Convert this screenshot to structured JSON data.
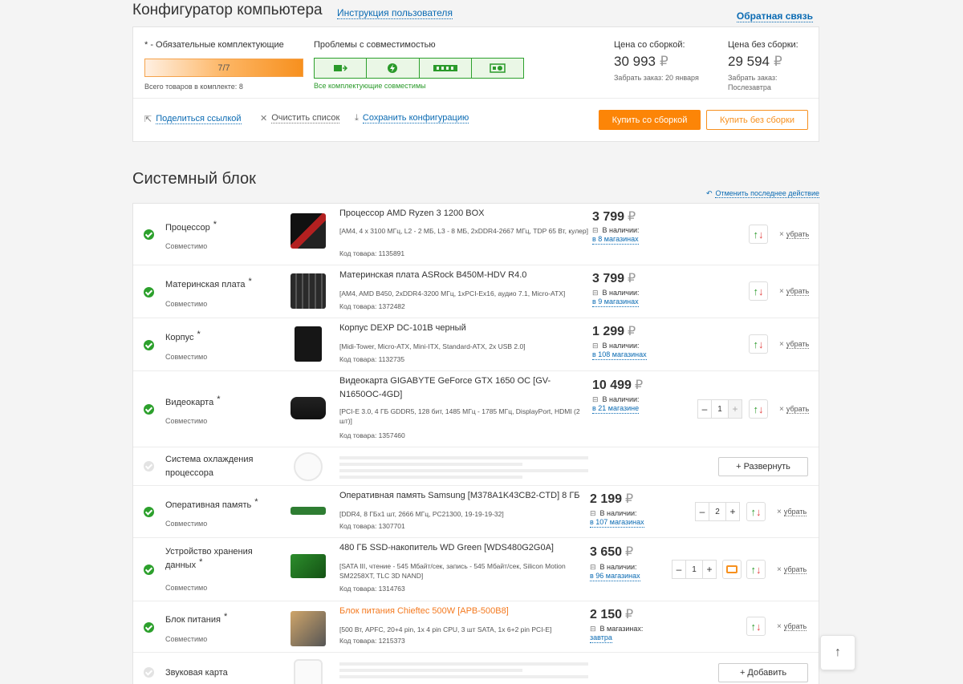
{
  "header": {
    "title": "Конфигуратор компьютера",
    "guide_link": "Инструкция пользователя",
    "feedback_link": "Обратная связь"
  },
  "summary": {
    "required_note": "* - Обязательные комплектующие",
    "progress_text": "7/7",
    "progress_fraction": 1.0,
    "total_items": "Всего товаров в комплекте: 8",
    "compat_title": "Проблемы с совместимостью",
    "compat_status": "Все комплектующие совместимы",
    "compat_icons": [
      "motherboard-icon",
      "power-icon",
      "ram-icon",
      "gpu-icon"
    ],
    "price_with_build_label": "Цена со сборкой:",
    "price_with_build": "30 993",
    "pickup_with_build": "Забрать заказ: 20 января",
    "price_without_build_label": "Цена без сборки:",
    "price_without_build": "29 594",
    "pickup_without_build": "Забрать заказ: Послезавтра",
    "currency": "₽",
    "share_link": "Поделиться ссылкой",
    "clear_list": "Очистить список",
    "save_config": "Сохранить конфигурацию",
    "buy_with_build": "Купить со сборкой",
    "buy_without_build": "Купить без сборки"
  },
  "section": {
    "title": "Системный блок",
    "undo": "Отменить последнее действие"
  },
  "labels": {
    "compatible": "Совместимо",
    "in_stock": "В наличии:",
    "in_stores": "В магазинах:",
    "remove": "убрать",
    "star": "*"
  },
  "rows": [
    {
      "category": "Процессор",
      "name": "Процессор AMD Ryzen 3 1200 BOX",
      "specs": "[AM4, 4 x 3100 МГц, L2 - 2 МБ, L3 - 8 МБ, 2xDDR4-2667 МГц, TDP 65 Вт, кулер]",
      "code": "Код товара: 1135891",
      "price": "3 799",
      "stores": "в 8 магазинах"
    },
    {
      "category": "Материнская плата",
      "name": "Материнская плата ASRock B450M-HDV R4.0",
      "specs": "[AM4, AMD B450, 2xDDR4-3200 МГц, 1xPCI-Ex16, аудио 7.1, Micro-ATX]",
      "code": "Код товара: 1372482",
      "price": "3 799",
      "stores": "в 9 магазинах"
    },
    {
      "category": "Корпус",
      "name": "Корпус DEXP DC-101B черный",
      "specs": "[Midi-Tower, Micro-ATX, Mini-ITX, Standard-ATX, 2x USB 2.0]",
      "code": "Код товара: 1132735",
      "price": "1 299",
      "stores": "в 108 магазинах"
    },
    {
      "category": "Видеокарта",
      "name": "Видеокарта GIGABYTE GeForce GTX 1650 OC [GV-N1650OC-4GD]",
      "specs": "[PCI-E 3.0, 4 ГБ GDDR5, 128 бит, 1485 МГц - 1785 МГц, DisplayPort, HDMI (2 шт)]",
      "code": "Код товара: 1357460",
      "price": "10 499",
      "stores": "в 21 магазине",
      "qty": "1"
    },
    {
      "category": "Система охлаждения процессора",
      "expand": "+ Развернуть"
    },
    {
      "category": "Оперативная память",
      "name": "Оперативная память Samsung [M378A1K43CB2-CTD] 8 ГБ",
      "specs": "[DDR4, 8 ГБx1 шт, 2666 МГц, PC21300, 19-19-19-32]",
      "code": "Код товара: 1307701",
      "price": "2 199",
      "stores": "в 107 магазинах",
      "qty": "2"
    },
    {
      "category": "Устройство хранения данных",
      "name": "480 ГБ SSD-накопитель WD Green [WDS480G2G0A]",
      "specs": "[SATA III, чтение - 545 Мбайт/сек, запись - 545 Мбайт/сек, Silicon Motion SM2258XT, TLC 3D NAND]",
      "code": "Код товара: 1314763",
      "price": "3 650",
      "stores": "в 96 магазинах",
      "qty": "1"
    },
    {
      "category": "Блок питания",
      "name": "Блок питания Chieftec 500W [APB-500B8]",
      "specs": "[500 Вт, APFC, 20+4 pin, 1x 4 pin CPU, 3 шт SATA, 1x 6+2 pin PCI-E]",
      "code": "Код товара: 1215373",
      "price": "2 150",
      "stores": "завтра"
    },
    {
      "category": "Звуковая карта",
      "add": "+ Добавить"
    }
  ],
  "colors": {
    "accent": "#fc8507",
    "link": "#0b6bb3",
    "ok": "#2ca02c"
  }
}
